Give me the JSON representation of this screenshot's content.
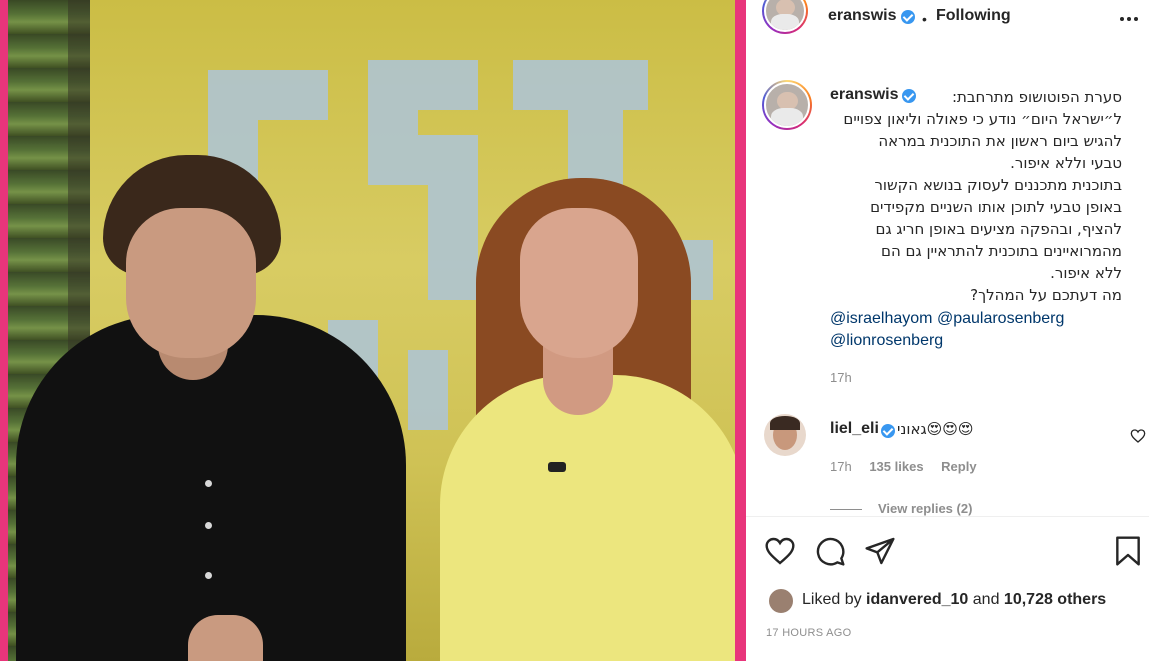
{
  "post_header": {
    "username": "eranswis",
    "separator": "•",
    "follow_status": "Following",
    "more_icon": "more-horizontal-icon"
  },
  "caption": {
    "username": "eranswis",
    "lines": [
      "סערת הפוטושופ מתרחבת:",
      "ל״ישראל היום״ נודע כי פאולה וליאון צפויים",
      "להגיש ביום ראשון את התוכנית במראה",
      "טבעי וללא איפור.",
      "בתוכנית מתכננים לעסוק בנושא הקשור",
      "באופן טבעי לתוכן אותו השניים מקפידים",
      "להציף, ובהפקה מציעים באופן חריג גם",
      "מהמרואיינים בתוכנית להתראיין גם הם",
      "ללא איפור.",
      "מה דעתכם על המהלך?"
    ],
    "mentions": [
      "@israelhayom",
      "@paularosenberg",
      "@lionrosenberg"
    ],
    "time": "17h"
  },
  "comment": {
    "username": "liel_eli",
    "text": "גאוני😍😍😍",
    "time": "17h",
    "likes": "135 likes",
    "reply": "Reply",
    "view_replies": "View replies (2)",
    "like_icon": "heart-outline-icon"
  },
  "actions": {
    "like_icon": "heart-icon",
    "comment_icon": "comment-bubble-icon",
    "share_icon": "paper-plane-icon",
    "save_icon": "bookmark-icon"
  },
  "likes": {
    "prefix": "Liked by ",
    "user": "idanvered_10",
    "middle": " and ",
    "others": "10,728 others"
  },
  "post_time": "17 HOURS AGO",
  "colors": {
    "frame": "#e8357b",
    "verified": "#3897f0",
    "link": "#00376b",
    "muted": "#8e8e8e"
  }
}
